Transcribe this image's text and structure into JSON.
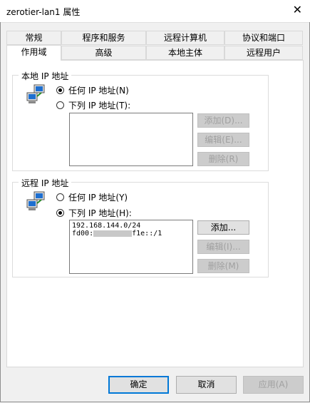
{
  "window": {
    "title": "zerotier-lan1 属性",
    "close_symbol": "✕"
  },
  "tabs_top": [
    "常规",
    "程序和服务",
    "远程计算机",
    "协议和端口"
  ],
  "tabs_bottom": [
    "作用域",
    "高级",
    "本地主体",
    "远程用户"
  ],
  "active_tab": "作用域",
  "local": {
    "title": "本地 IP 地址",
    "option_any": "任何 IP 地址(N)",
    "option_list": "下列 IP 地址(T):",
    "selected": "any",
    "buttons": {
      "add": "添加(D)...",
      "edit": "编辑(E)...",
      "remove": "删除(R)"
    }
  },
  "remote": {
    "title": "远程 IP 地址",
    "option_any": "任何 IP 地址(Y)",
    "option_list": "下列 IP 地址(H):",
    "selected": "list",
    "entries": {
      "first": "192.168.144.0/24",
      "second_prefix": "fd00:",
      "second_suffix": "f1e::/1"
    },
    "buttons": {
      "add": "添加...",
      "edit": "编辑(I)...",
      "remove": "删除(M)"
    }
  },
  "footer": {
    "ok": "确定",
    "cancel": "取消",
    "apply": "应用(A)"
  },
  "colors": {
    "accent": "#0078d7",
    "icon_screen": "#1e6fd0"
  },
  "icons": {
    "network": "network-computers-icon",
    "close": "close-icon"
  }
}
